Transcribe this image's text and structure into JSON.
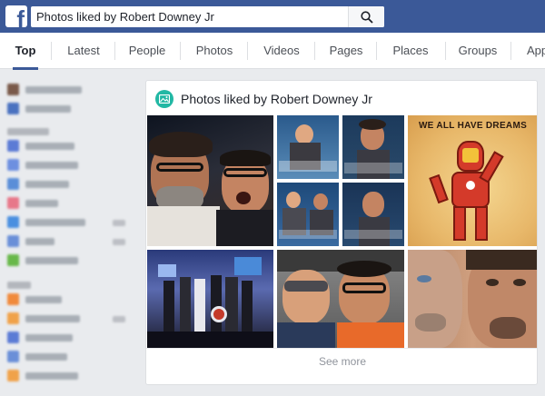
{
  "search": {
    "value": "Photos liked by Robert Downey Jr"
  },
  "tabs": [
    {
      "label": "Top"
    },
    {
      "label": "Latest"
    },
    {
      "label": "People"
    },
    {
      "label": "Photos"
    },
    {
      "label": "Videos"
    },
    {
      "label": "Pages"
    },
    {
      "label": "Places"
    },
    {
      "label": "Groups"
    },
    {
      "label": "App"
    }
  ],
  "card": {
    "title": "Photos liked by Robert Downey Jr",
    "see_more": "See more",
    "poster_text": "WE ALL HAVE DREAMS"
  },
  "colors": {
    "brand": "#3b5998",
    "page_bg": "#e9ebee",
    "card_icon": "#22b8a4"
  }
}
